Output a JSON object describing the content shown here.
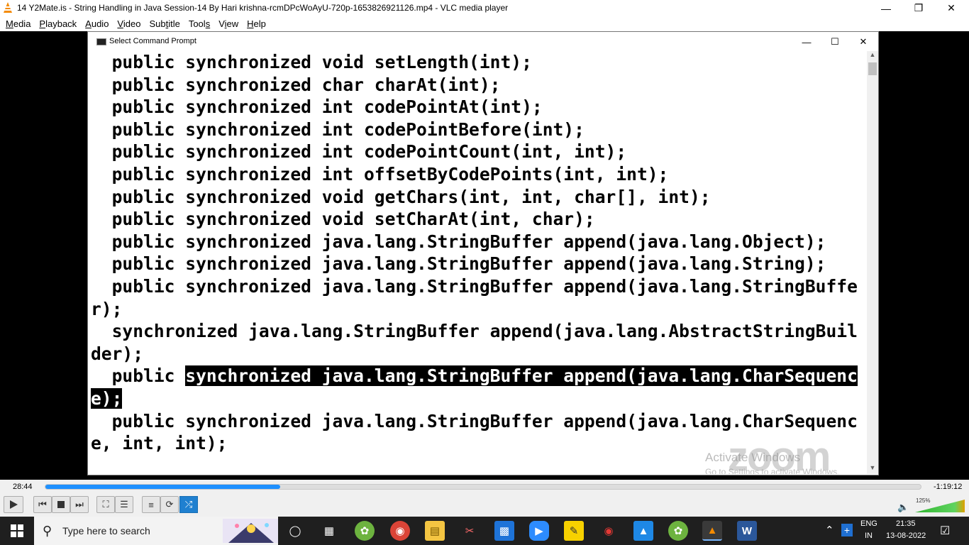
{
  "vlc": {
    "title": "14 Y2Mate.is - String Handling in Java  Session-14  By Hari krishna-rcmDPcWoAyU-720p-1653826921126.mp4 - VLC media player",
    "menu": [
      {
        "pre": "",
        "ul": "M",
        "post": "edia"
      },
      {
        "pre": "",
        "ul": "P",
        "post": "layback"
      },
      {
        "pre": "",
        "ul": "A",
        "post": "udio"
      },
      {
        "pre": "",
        "ul": "V",
        "post": "ideo"
      },
      {
        "pre": "Sub",
        "ul": "t",
        "post": "itle"
      },
      {
        "pre": "Tool",
        "ul": "s",
        "post": ""
      },
      {
        "pre": "V",
        "ul": "i",
        "post": "ew"
      },
      {
        "pre": "",
        "ul": "H",
        "post": "elp"
      }
    ],
    "time_elapsed": "28:44",
    "time_remaining": "-1:19:12",
    "progress_fraction": 0.268,
    "volume_percent": "125%",
    "accent": "#1e90ff"
  },
  "cmd": {
    "title": "Select Command Prompt",
    "lines": [
      {
        "text": "  public synchronized void setLength(int);"
      },
      {
        "text": "  public synchronized char charAt(int);"
      },
      {
        "text": "  public synchronized int codePointAt(int);"
      },
      {
        "text": "  public synchronized int codePointBefore(int);"
      },
      {
        "text": "  public synchronized int codePointCount(int, int);"
      },
      {
        "text": "  public synchronized int offsetByCodePoints(int, int);"
      },
      {
        "text": "  public synchronized void getChars(int, int, char[], int);"
      },
      {
        "text": "  public synchronized void setCharAt(int, char);"
      },
      {
        "text": "  public synchronized java.lang.StringBuffer append(java.lang.Object);"
      },
      {
        "text": "  public synchronized java.lang.StringBuffer append(java.lang.String);"
      },
      {
        "text": "  public synchronized java.lang.StringBuffer append(java.lang.StringBuffe"
      },
      {
        "text": "r);"
      },
      {
        "text": "  synchronized java.lang.StringBuffer append(java.lang.AbstractStringBuil"
      },
      {
        "text": "der);"
      },
      {
        "pre": "  public ",
        "sel": "synchronized java.lang.StringBuffer append(java.lang.CharSequenc"
      },
      {
        "sel": "e);"
      },
      {
        "text": "  public synchronized java.lang.StringBuffer append(java.lang.CharSequenc"
      },
      {
        "text": "e, int, int);"
      }
    ],
    "watermark_line1": "Activate Windows",
    "watermark_line2": "Go to Settings to activate Windows.",
    "logo_text": "zoom"
  },
  "taskbar": {
    "search_placeholder": "Type here to search",
    "lang_line1": "ENG",
    "lang_line2": "IN",
    "time": "21:35",
    "date": "13-08-2022",
    "apps": [
      "task-view",
      "spring-tool-suite",
      "chrome",
      "file-explorer",
      "bug-tool",
      "microsoft-store",
      "zoom",
      "sticky-notes",
      "record",
      "photos",
      "spring-tool-suite-2",
      "vlc",
      "word"
    ]
  }
}
